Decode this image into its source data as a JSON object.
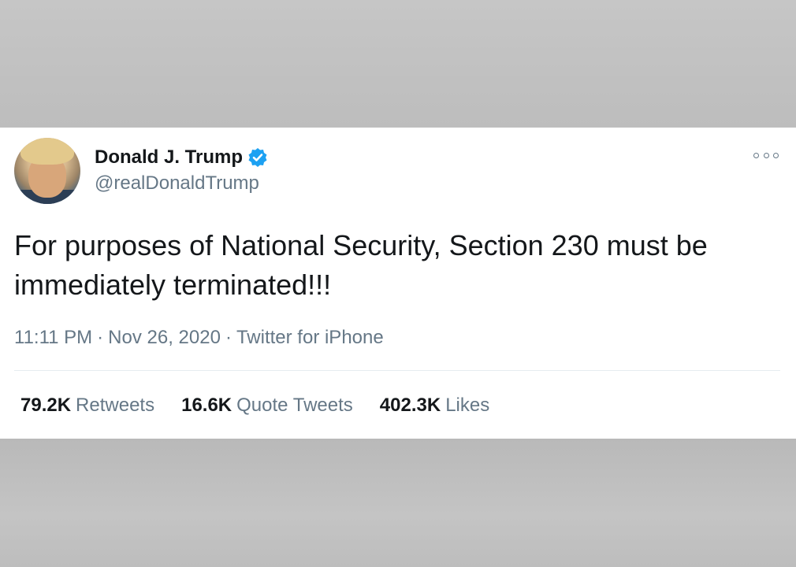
{
  "tweet": {
    "display_name": "Donald J. Trump",
    "handle": "@realDonaldTrump",
    "text": "For purposes of National Security, Section 230 must be immediately terminated!!!",
    "time": "11:11 PM",
    "date": "Nov 26, 2020",
    "source": "Twitter for iPhone",
    "separator": "·",
    "verified_icon": "verified-badge-icon",
    "more_icon": "more-options-icon"
  },
  "stats": {
    "retweets": {
      "count": "79.2K",
      "label": "Retweets"
    },
    "quote_tweets": {
      "count": "16.6K",
      "label": "Quote Tweets"
    },
    "likes": {
      "count": "402.3K",
      "label": "Likes"
    }
  },
  "colors": {
    "primary_text": "#14171a",
    "secondary_text": "#657786",
    "verified_blue": "#1da1f2",
    "divider": "#e6ecf0"
  }
}
